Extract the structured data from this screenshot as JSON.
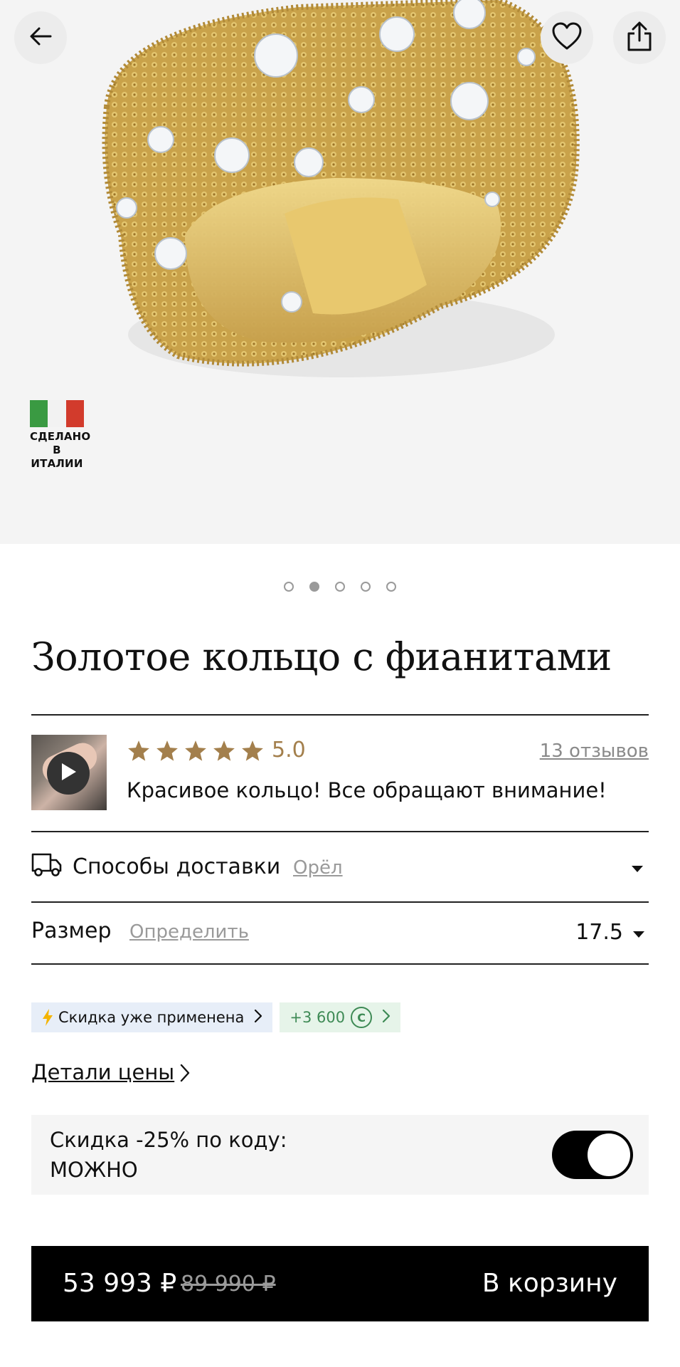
{
  "product": {
    "title": "Золотое кольцо с фианитами",
    "badge_line1": "СДЕЛАНО",
    "badge_line2": "В ИТАЛИИ"
  },
  "gallery": {
    "count": 5,
    "active_index": 1
  },
  "review": {
    "rating": 5.0,
    "score_text": "5.0",
    "reviews_link": "13 отзывов",
    "text": "Красивое кольцо! Все обращают внимание!"
  },
  "delivery": {
    "label": "Способы доставки",
    "city": "Орёл"
  },
  "size": {
    "label": "Размер",
    "measure_link": "Определить",
    "value": "17.5"
  },
  "badges": {
    "discount": "Скидка уже применена",
    "bonus": "+3 600"
  },
  "price_details": "Детали цены",
  "promo": {
    "line1": "Скидка -25% по коду:",
    "line2": "МОЖНО",
    "enabled": true
  },
  "cart": {
    "price": "53 993 ₽",
    "old_price": "89 990 ₽",
    "button": "В корзину"
  },
  "icons": {
    "back": "arrow-left-icon",
    "favorite": "heart-icon",
    "share": "share-icon",
    "delivery": "truck-icon",
    "play": "play-icon",
    "star": "star-icon",
    "bolt": "lightning-icon",
    "coin": "coin-icon"
  },
  "colors": {
    "star": "#a37f4c",
    "bonus_green": "#3e8a55",
    "discount_bg": "#e7eef8",
    "bonus_bg": "#e6f4e9"
  }
}
